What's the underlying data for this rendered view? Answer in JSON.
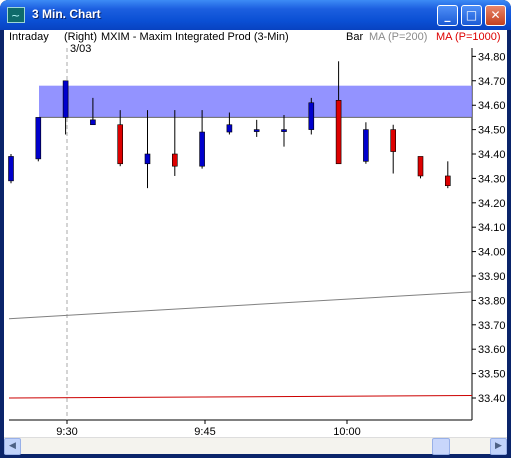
{
  "window": {
    "title": "3 Min. Chart",
    "controls": [
      "minimize",
      "maximize",
      "close"
    ]
  },
  "header": {
    "interval": "Intraday",
    "axis_side": "(Right)",
    "symbol": "MXIM - Maxim Integrated Prod  (3-Min)",
    "style": "Bar",
    "ma200": "MA (P=200)",
    "ma1000": "MA (P=1000)",
    "date": "3/03"
  },
  "colors": {
    "up": "#0000cc",
    "down": "#dd0000",
    "ma200": "#808080",
    "ma1000": "#cc0000",
    "zone": "#8080ff"
  },
  "chart_data": {
    "type": "candlestick",
    "y_ticks": [
      "34.80",
      "34.70",
      "34.60",
      "34.50",
      "34.40",
      "34.30",
      "34.20",
      "34.10",
      "34.00",
      "33.90",
      "33.80",
      "33.70",
      "33.60",
      "33.50",
      "33.40"
    ],
    "x_ticks": [
      "9:30",
      "9:45",
      "10:00"
    ],
    "ylim": [
      33.4,
      34.8
    ],
    "candles": [
      {
        "o": 34.29,
        "h": 34.4,
        "l": 34.28,
        "c": 34.39
      },
      {
        "o": 34.38,
        "h": 34.55,
        "l": 34.37,
        "c": 34.55
      },
      {
        "o": 34.55,
        "h": 34.7,
        "l": 34.48,
        "c": 34.7
      },
      {
        "o": 34.52,
        "h": 34.63,
        "l": 34.52,
        "c": 34.54
      },
      {
        "o": 34.52,
        "h": 34.58,
        "l": 34.35,
        "c": 34.36
      },
      {
        "o": 34.36,
        "h": 34.58,
        "l": 34.26,
        "c": 34.4
      },
      {
        "o": 34.4,
        "h": 34.58,
        "l": 34.31,
        "c": 34.35
      },
      {
        "o": 34.35,
        "h": 34.58,
        "l": 34.34,
        "c": 34.49
      },
      {
        "o": 34.49,
        "h": 34.57,
        "l": 34.48,
        "c": 34.52
      },
      {
        "o": 34.5,
        "h": 34.54,
        "l": 34.47,
        "c": 34.5
      },
      {
        "o": 34.5,
        "h": 34.56,
        "l": 34.43,
        "c": 34.5
      },
      {
        "o": 34.5,
        "h": 34.63,
        "l": 34.48,
        "c": 34.61
      },
      {
        "o": 34.62,
        "h": 34.78,
        "l": 34.36,
        "c": 34.36
      },
      {
        "o": 34.37,
        "h": 34.53,
        "l": 34.36,
        "c": 34.5
      },
      {
        "o": 34.5,
        "h": 34.52,
        "l": 34.32,
        "c": 34.41
      },
      {
        "o": 34.39,
        "h": 34.39,
        "l": 34.3,
        "c": 34.31
      },
      {
        "o": 34.31,
        "h": 34.37,
        "l": 34.26,
        "c": 34.27
      }
    ],
    "highlight_zone": [
      34.55,
      34.68
    ],
    "ma200": [
      33.725,
      33.835
    ],
    "ma1000": [
      33.4,
      33.41
    ]
  }
}
